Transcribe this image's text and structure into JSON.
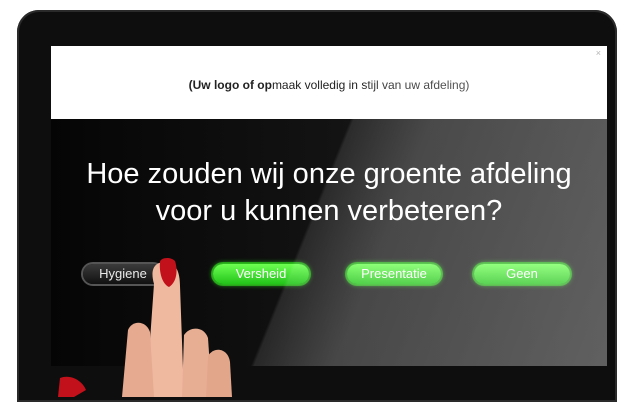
{
  "logo_bar": {
    "text_bold": "(Uw logo of op",
    "text_rest": "maak volledig in stijl van uw afdeling)",
    "close_glyph": "×"
  },
  "question": {
    "line1": "Hoe zouden wij onze groente afdeling",
    "line2": "voor u kunnen verbeteren?"
  },
  "answers": [
    {
      "label": "Hygiene",
      "style": "dark"
    },
    {
      "label": "Versheid",
      "style": "green"
    },
    {
      "label": "Presentatie",
      "style": "green"
    },
    {
      "label": "Geen",
      "style": "green"
    }
  ],
  "colors": {
    "button_green": "#3cdf2a",
    "button_dark": "#2a2a2a",
    "nail_red": "#c2111a",
    "skin": "#efb9a0"
  }
}
